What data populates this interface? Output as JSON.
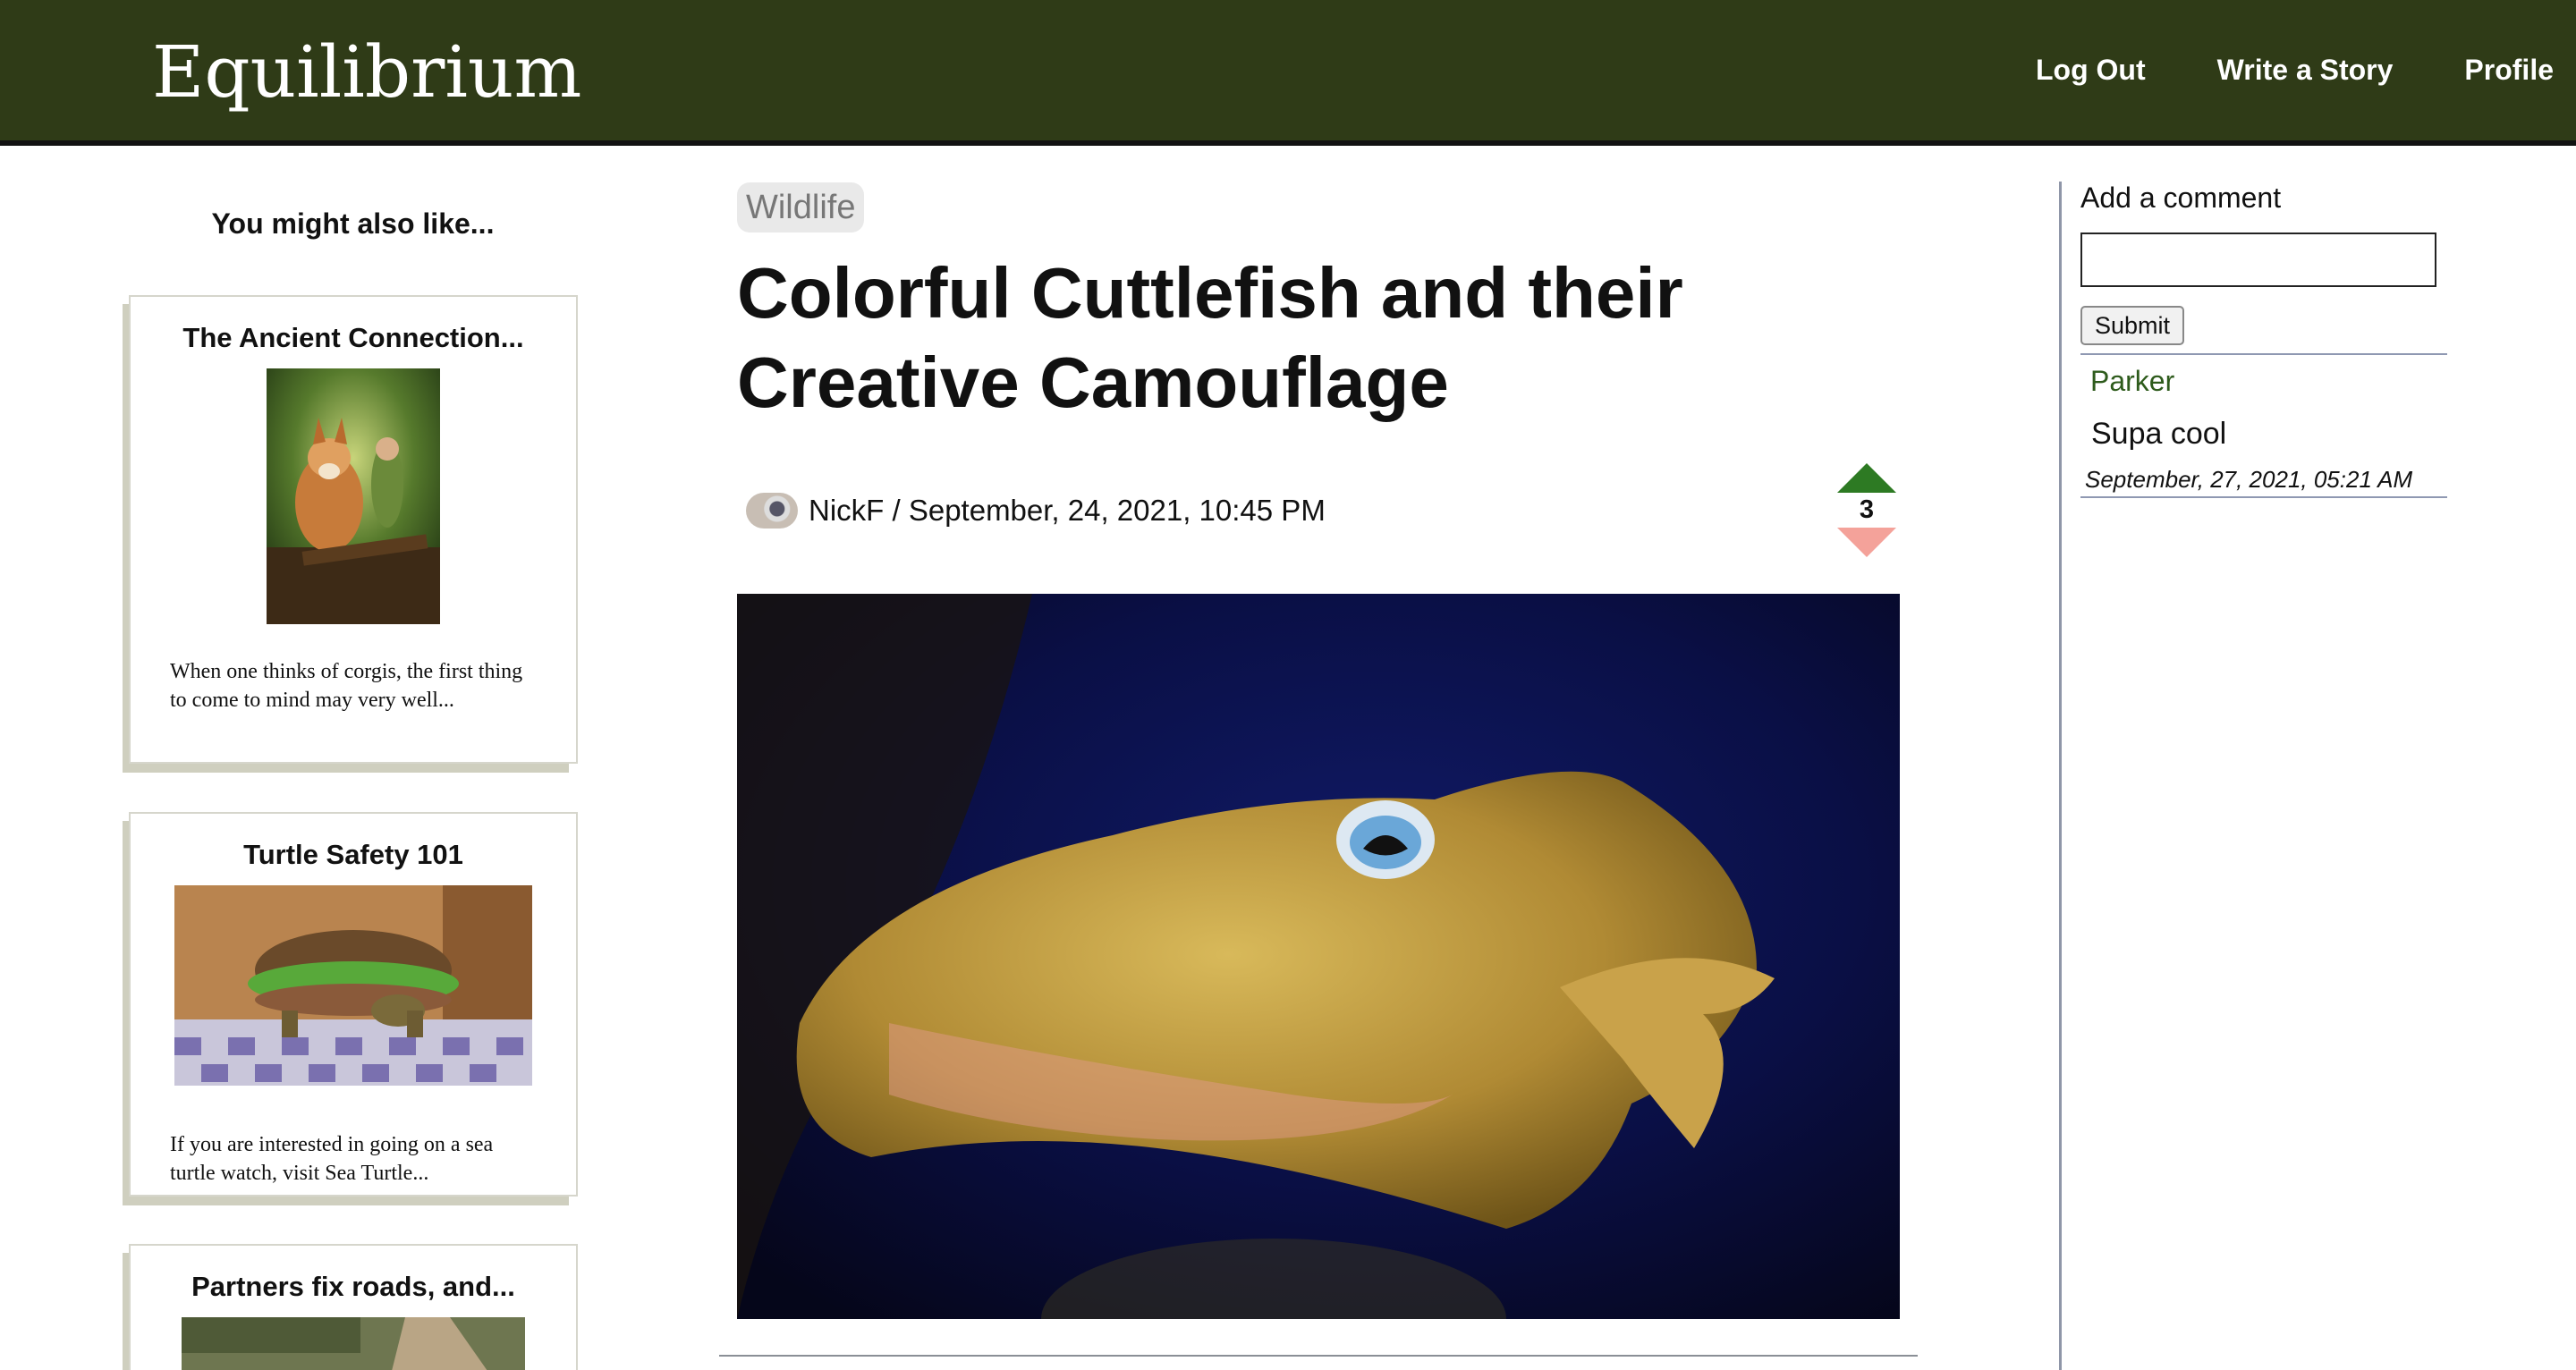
{
  "nav": {
    "brand": "Equilibrium",
    "links": [
      "Log Out",
      "Write a Story",
      "Profile"
    ],
    "bg_color": "#2f3b17"
  },
  "sidebar": {
    "title": "You might also like...",
    "cards": [
      {
        "title": "The Ancient Connection...",
        "excerpt": "When one thinks of corgis, the first thing to come to mind may very well..."
      },
      {
        "title": "Turtle Safety 101",
        "excerpt": "If you are interested in going on a sea turtle watch, visit Sea Turtle..."
      },
      {
        "title": "Partners fix roads, and..."
      }
    ]
  },
  "story": {
    "tag": "Wildlife",
    "title": "Colorful Cuttlefish and their Creative Camouflage",
    "byline": "NickF / September, 24, 2021, 10:45 PM",
    "votes": "3"
  },
  "comments": {
    "label": "Add a comment",
    "input_value": "",
    "submit_label": "Submit",
    "items": [
      {
        "user": "Parker",
        "text": "Supa cool",
        "date": "September, 27, 2021, 05:21 AM"
      }
    ]
  }
}
